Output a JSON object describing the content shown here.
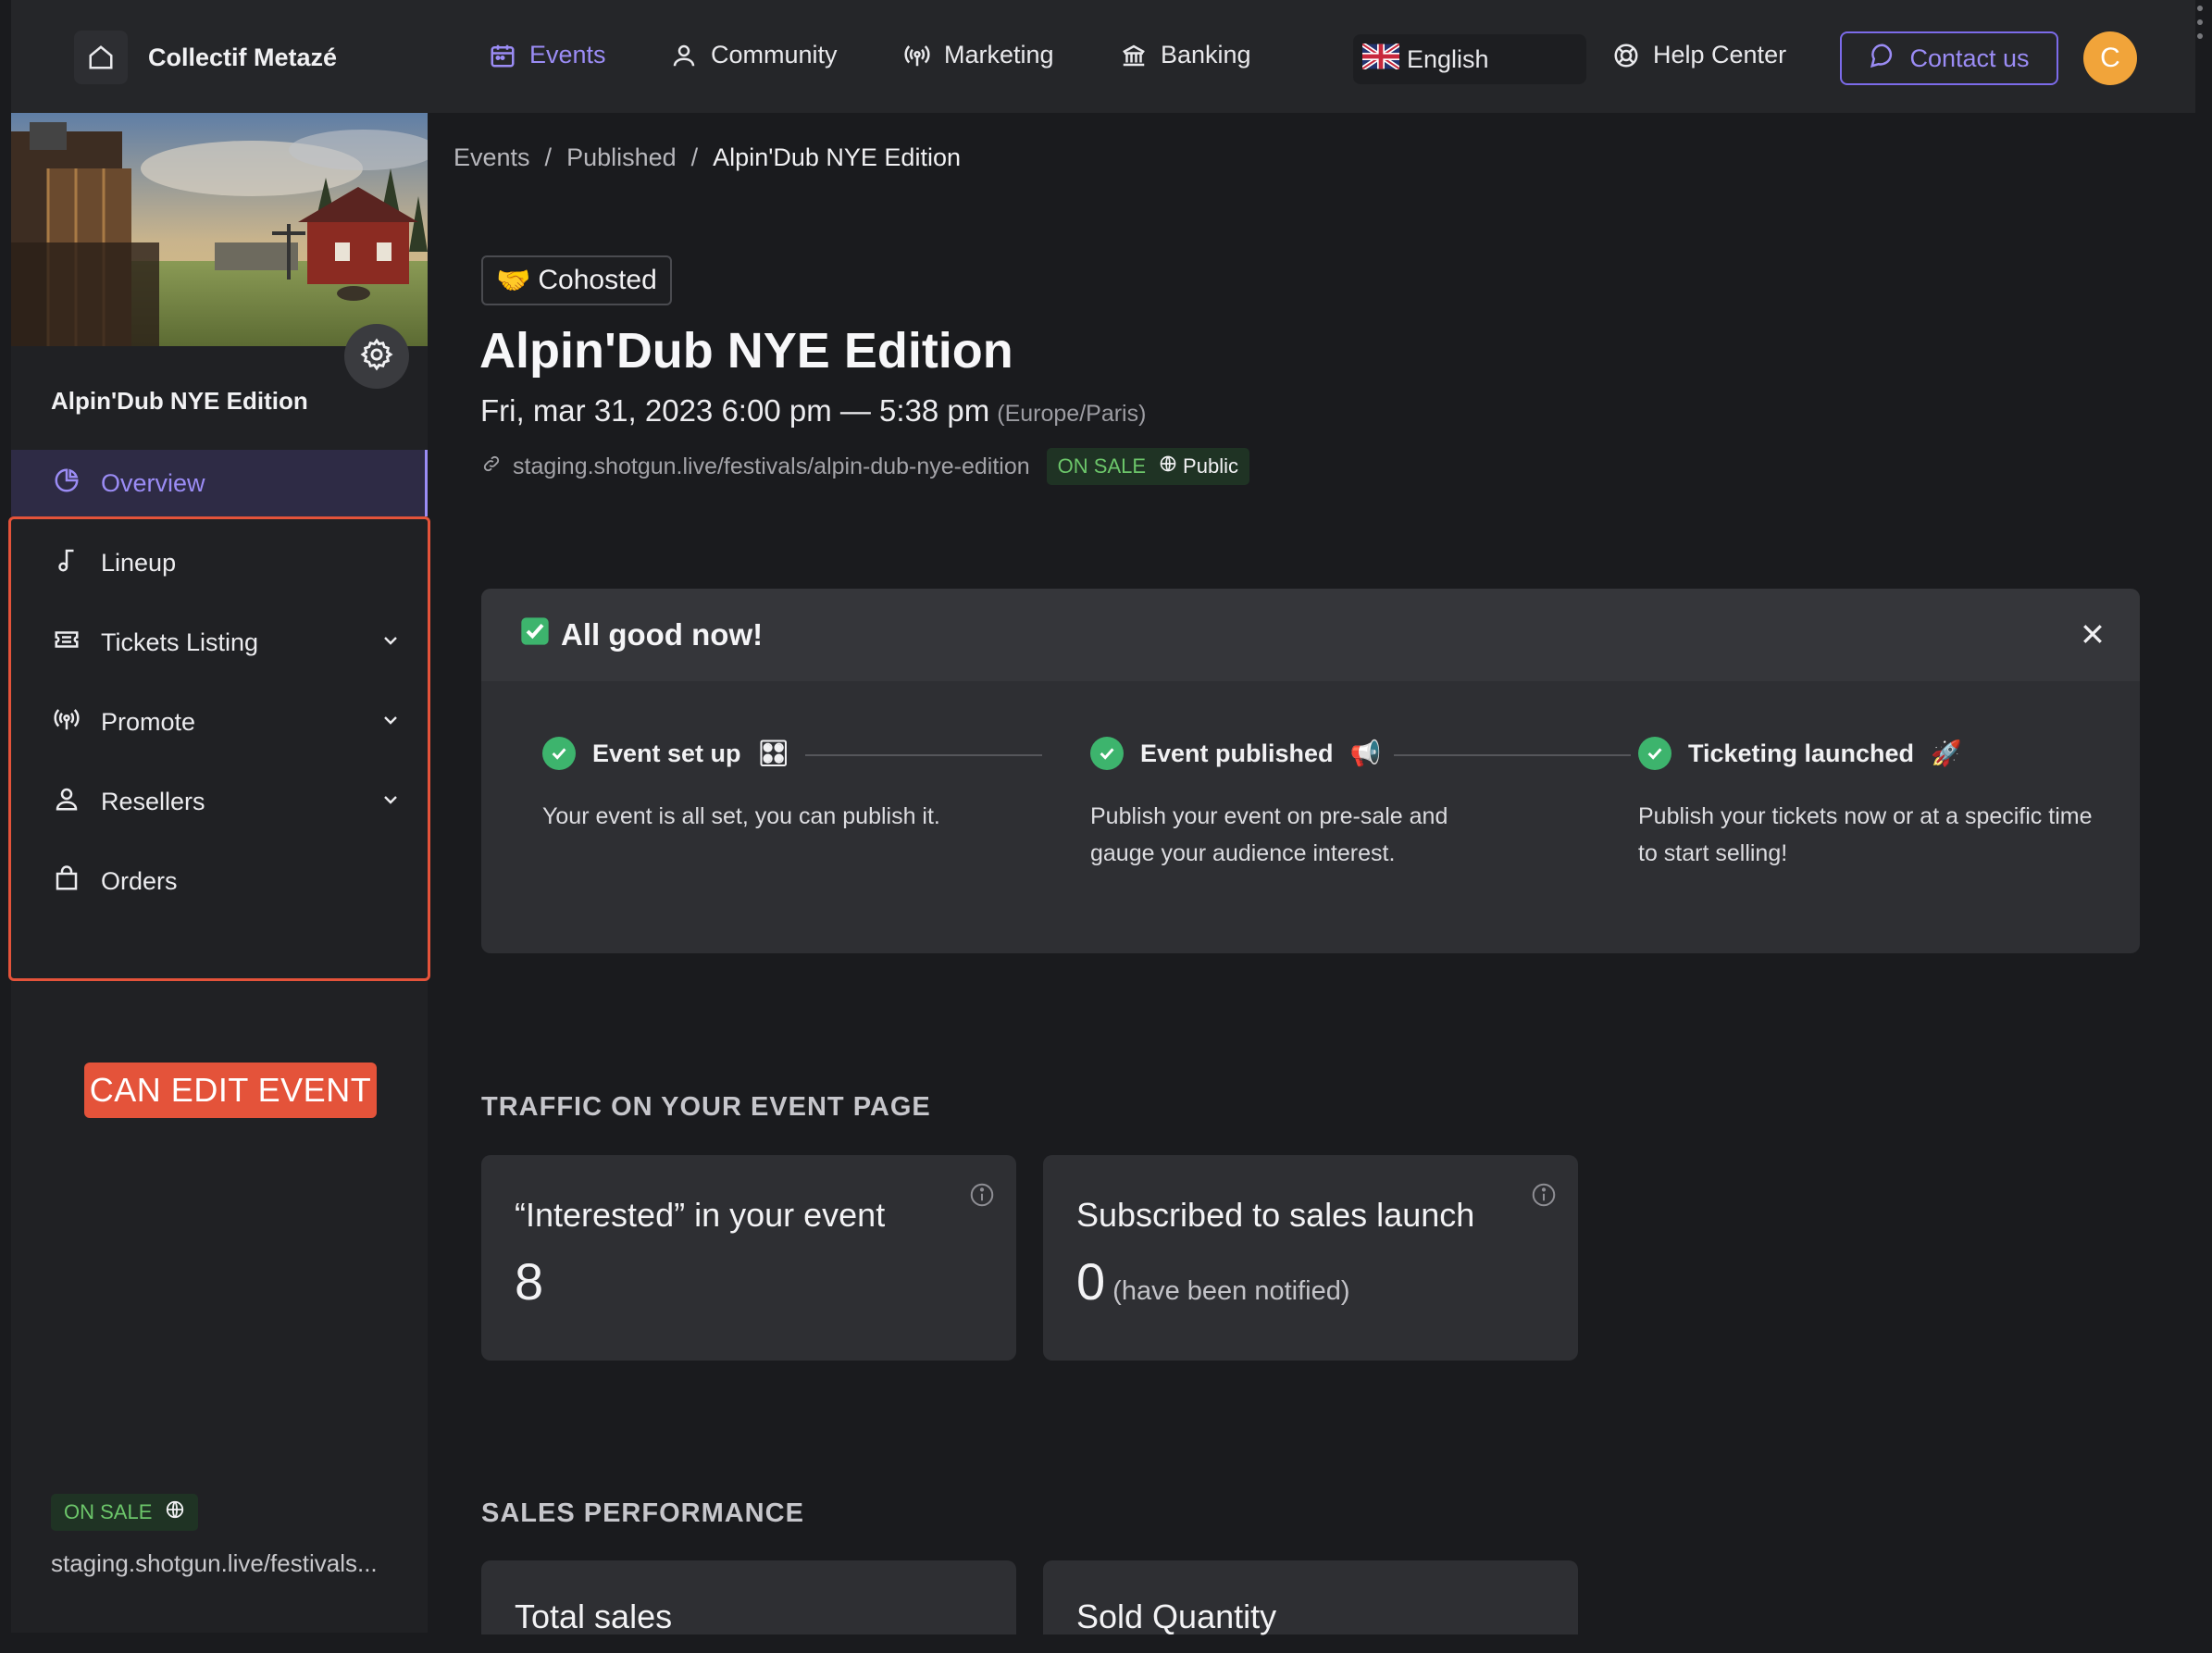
{
  "brand": {
    "name": "Collectif Metazé"
  },
  "nav": {
    "events": "Events",
    "community": "Community",
    "marketing": "Marketing",
    "banking": "Banking",
    "language": "English",
    "help": "Help Center",
    "contact": "Contact us",
    "avatar_initial": "C"
  },
  "sidebar": {
    "event_title": "Alpin'Dub NYE Edition",
    "items": [
      {
        "label": "Overview"
      },
      {
        "label": "Lineup"
      },
      {
        "label": "Tickets Listing"
      },
      {
        "label": "Promote"
      },
      {
        "label": "Resellers"
      },
      {
        "label": "Orders"
      }
    ],
    "annotation": "CAN EDIT EVENT",
    "status": "ON SALE",
    "url": "staging.shotgun.live/festivals..."
  },
  "breadcrumb": [
    "Events",
    "/",
    "Published",
    "/",
    "Alpin'Dub NYE Edition"
  ],
  "event": {
    "badge": "Cohosted",
    "title": "Alpin'Dub NYE Edition",
    "date": "Fri, mar 31, 2023 6:00 pm — 5:38 pm",
    "timezone": "(Europe/Paris)",
    "url": "staging.shotgun.live/festivals/alpin-dub-nye-edition",
    "status": "ON SALE",
    "visibility": "Public"
  },
  "checklist": {
    "title": "All good now!",
    "steps": [
      {
        "title": "Event set up",
        "emoji": "🎛",
        "desc": "Your event is all set, you can publish it."
      },
      {
        "title": "Event published",
        "emoji": "📢",
        "desc": "Publish your event on pre-sale and gauge your audience interest."
      },
      {
        "title": "Ticketing launched",
        "emoji": "🚀",
        "desc": "Publish your tickets now or at a specific time to start selling!"
      }
    ]
  },
  "traffic": {
    "heading": "TRAFFIC ON YOUR EVENT PAGE",
    "interested_label": "“Interested” in your event",
    "interested_value": "8",
    "subscribed_label": "Subscribed to sales launch",
    "subscribed_value": "0",
    "subscribed_note": "(have been notified)"
  },
  "sales": {
    "heading": "SALES PERFORMANCE",
    "total_label": "Total sales",
    "sold_label": "Sold Quantity"
  },
  "colors": {
    "accent": "#9b8cf5",
    "annotation_red": "#e4533a",
    "success_green": "#3db46d",
    "on_sale_green": "#6cc66a",
    "avatar_orange": "#f1a43a"
  },
  "icons": [
    "home-icon",
    "calendar-icon",
    "user-icon",
    "broadcast-icon",
    "bank-icon",
    "uk-flag-icon",
    "lifebuoy-icon",
    "chat-bubble-icon",
    "gear-icon",
    "pie-chart-icon",
    "music-note-icon",
    "ticket-icon",
    "user-outline-icon",
    "shopping-bag-icon",
    "chevron-down-icon",
    "globe-icon",
    "link-icon",
    "check-circle-icon",
    "close-icon",
    "info-icon"
  ]
}
